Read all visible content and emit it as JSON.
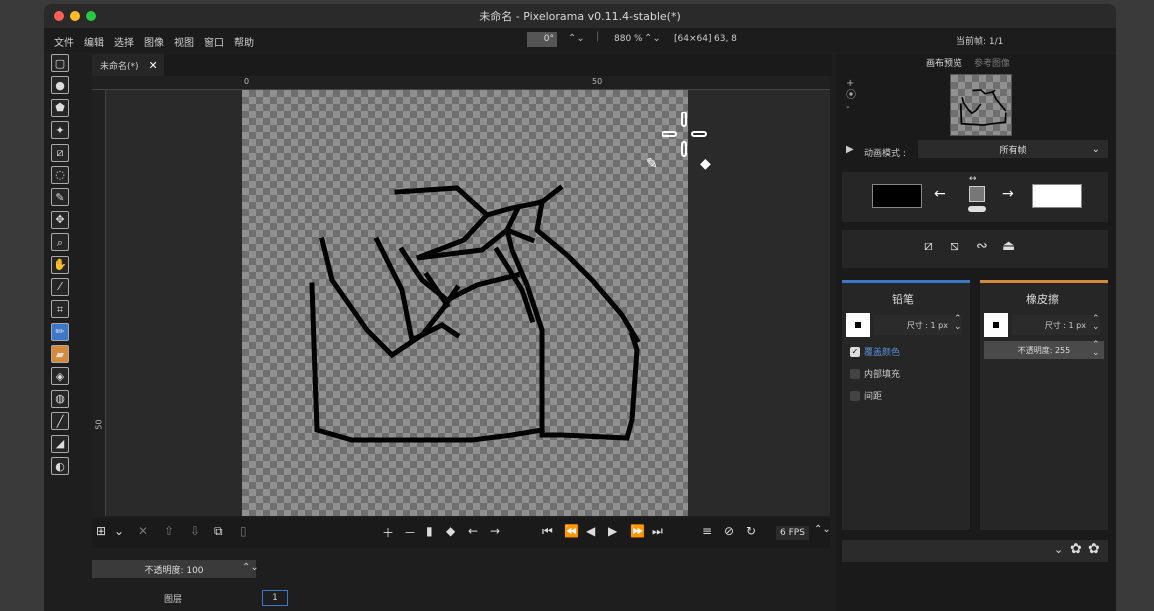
{
  "window": {
    "title": "未命名 - Pixelorama v0.11.4-stable(*)"
  },
  "menu": [
    "文件",
    "编辑",
    "选择",
    "图像",
    "视图",
    "窗口",
    "帮助"
  ],
  "top": {
    "rotation": "0°",
    "zoom": "880 %",
    "canvas_size": "[64×64]",
    "cursor_pos": "63, 8",
    "current_frame": "当前帧:  1/1"
  },
  "tab": {
    "label": "未命名(*)",
    "close": "✕"
  },
  "ruler": {
    "h0": "0",
    "h50": "50",
    "v50": "50"
  },
  "right": {
    "tab_canvas_preview": "画布预览",
    "tab_reference": "参考图像",
    "anim_mode_label": "动画模式 :",
    "anim_mode_value": "所有帧"
  },
  "left_tool_panel": {
    "title": "铅笔",
    "size_label": "尺寸 :  1 px",
    "opt1": "覆盖颜色",
    "opt2": "内部填充",
    "opt3": "间距"
  },
  "right_tool_panel": {
    "title": "橡皮擦",
    "size_label": "尺寸 :  1 px",
    "opacity": "不透明度: 255"
  },
  "layers": {
    "opacity": "不透明度: 100",
    "header": "图层",
    "frame_num": "1"
  },
  "timeline": {
    "fps": "6 FPS"
  },
  "colors": {
    "left": "#000000",
    "right": "#ffffff",
    "accent_blue": "#3b78c8",
    "accent_orange": "#d48a3a"
  }
}
